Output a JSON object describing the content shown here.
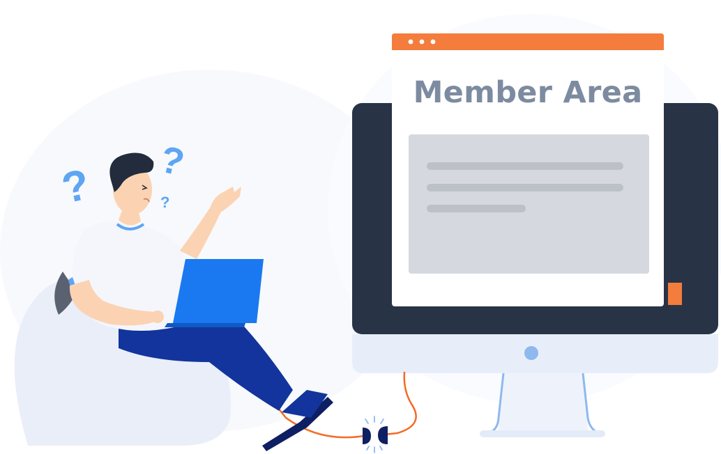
{
  "window": {
    "title": "Member Area",
    "title_color": "#7d8ba0",
    "header_color": "#f47c3c"
  },
  "monitor": {
    "screen_color": "#283445",
    "frame_color": "#e8eef9"
  },
  "person": {
    "shirt_color": "#f4f6fb",
    "pants_color": "#12349c",
    "laptop_color": "#1a79f0"
  },
  "decorations": {
    "question_mark_color": "#5ea5f2",
    "cable_color": "#f46a25",
    "plug_color": "#0e1f63"
  }
}
